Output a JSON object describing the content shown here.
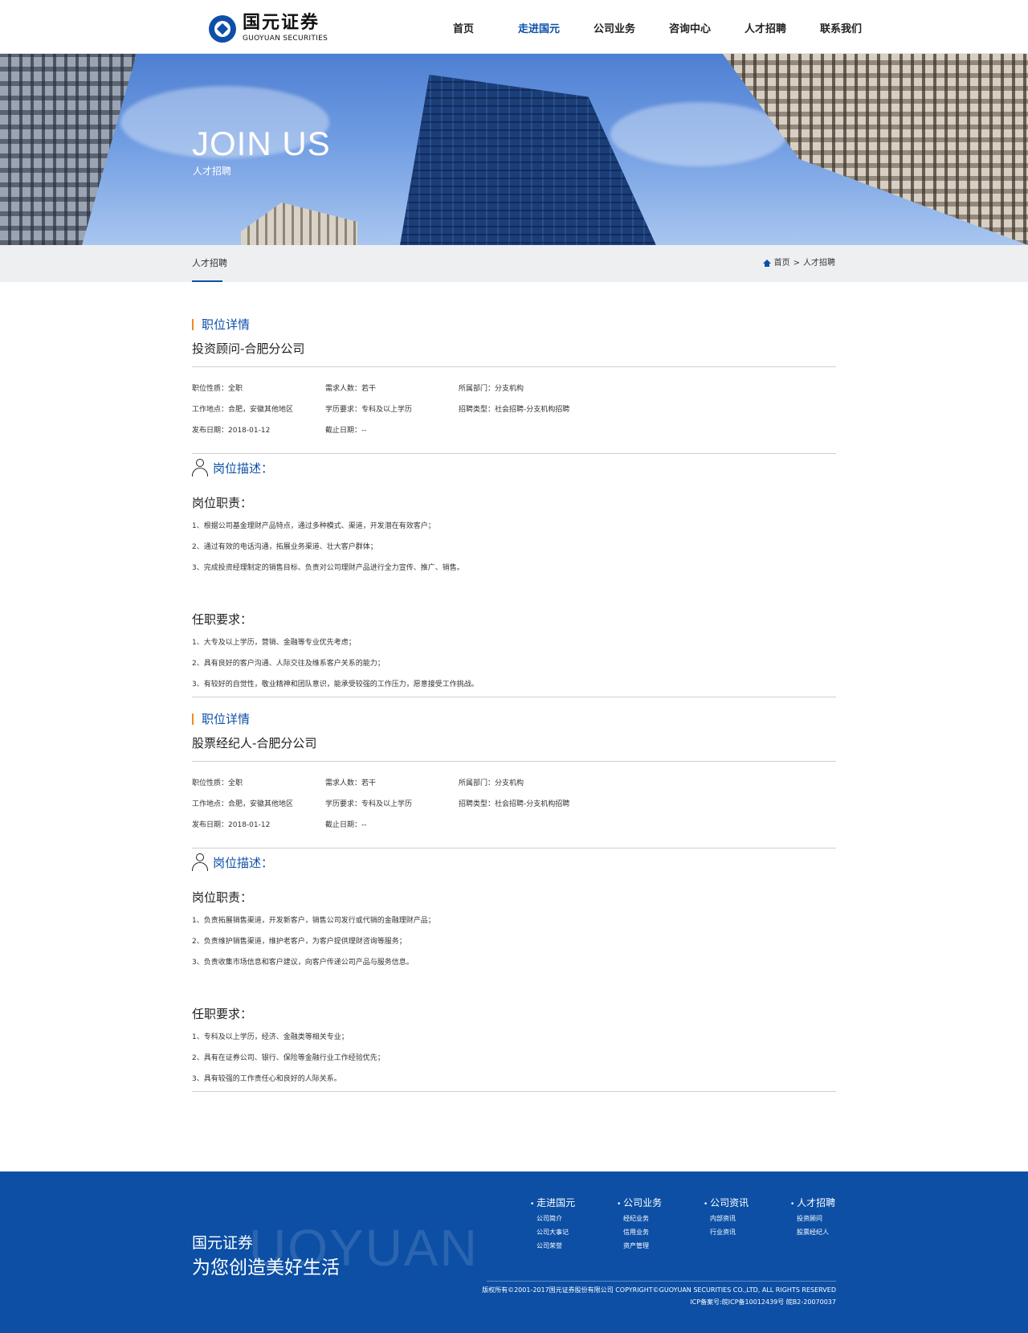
{
  "header": {
    "logo_cn": "国元证券",
    "logo_en": "GUOYUAN SECURITIES",
    "nav": [
      {
        "label": "首页",
        "active": false
      },
      {
        "label": "走进国元",
        "active": true
      },
      {
        "label": "公司业务",
        "active": false
      },
      {
        "label": "咨询中心",
        "active": false
      },
      {
        "label": "人才招聘",
        "active": false
      },
      {
        "label": "联系我们",
        "active": false
      }
    ]
  },
  "banner": {
    "title": "JOIN US",
    "subtitle": "人才招聘"
  },
  "subbar": {
    "title": "人才招聘",
    "breadcrumb": {
      "home": "首页",
      "sep": ">",
      "current": "人才招聘"
    }
  },
  "jobs": [
    {
      "tag": "职位详情",
      "title": "投资顾问-合肥分公司",
      "info": [
        [
          "职位性质：全职",
          "需求人数：若干",
          "所属部门：分支机构"
        ],
        [
          "工作地点：合肥，安徽其他地区",
          "学历要求：专科及以上学历",
          "招聘类型：社会招聘-分支机构招聘"
        ],
        [
          "发布日期：2018-01-12",
          "截止日期：--",
          ""
        ]
      ],
      "desc_label": "岗位描述：",
      "duty_title": "岗位职责：",
      "duties": [
        "1、根据公司基金理财产品特点，通过多种模式、渠道，开发潜在有效客户；",
        "2、通过有效的电话沟通，拓展业务渠道、壮大客户群体；",
        "3、完成投资经理制定的销售目标、负责对公司理财产品进行全力宣传、推广、销售。"
      ],
      "req_title": "任职要求：",
      "requirements": [
        "1、大专及以上学历，营销、金融等专业优先考虑；",
        "2、具有良好的客户沟通、人际交往及维系客户关系的能力；",
        "3、有较好的自觉性，敬业精神和团队意识，能承受较强的工作压力，愿意接受工作挑战。"
      ]
    },
    {
      "tag": "职位详情",
      "title": "股票经纪人-合肥分公司",
      "info": [
        [
          "职位性质：全职",
          "需求人数：若干",
          "所属部门：分支机构"
        ],
        [
          "工作地点：合肥，安徽其他地区",
          "学历要求：专科及以上学历",
          "招聘类型：社会招聘-分支机构招聘"
        ],
        [
          "发布日期：2018-01-12",
          "截止日期：--",
          ""
        ]
      ],
      "desc_label": "岗位描述：",
      "duty_title": "岗位职责：",
      "duties": [
        "1、负责拓展销售渠道，开发新客户，销售公司发行或代销的金融理财产品；",
        "2、负责维护销售渠道，维护老客户，为客户提供理财咨询等服务；",
        "3、负责收集市场信息和客户建议，向客户传递公司产品与服务信息。"
      ],
      "req_title": "任职要求：",
      "requirements": [
        "1、专科及以上学历，经济、金融类等相关专业；",
        "2、具有在证券公司、银行、保险等金融行业工作经验优先；",
        "3、具有较强的工作责任心和良好的人际关系。"
      ]
    }
  ],
  "footer": {
    "bg_text": "UOYUAN",
    "slogan1": "国元证券",
    "slogan2": "为您创造美好生活",
    "columns": [
      {
        "title": "走进国元",
        "items": [
          "公司简介",
          "公司大事记",
          "公司荣誉"
        ]
      },
      {
        "title": "公司业务",
        "items": [
          "经纪业务",
          "信用业务",
          "资产管理"
        ]
      },
      {
        "title": "公司资讯",
        "items": [
          "内部资讯",
          "行业资讯"
        ]
      },
      {
        "title": "人才招聘",
        "items": [
          "投资顾问",
          "股票经纪人"
        ]
      }
    ],
    "copyright": "版权所有©2001-2017国元证券股份有限公司 COPYRIGHT©GUOYUAN SECURITIES CO.,LTD, ALL RIGHTS RESERVED",
    "icp": "ICP备案号:皖ICP备10012439号 皖B2-20070037"
  },
  "colors": {
    "brand": "#0e4fa8",
    "accent": "#f28b1e",
    "footer": "#0c4fa5"
  }
}
